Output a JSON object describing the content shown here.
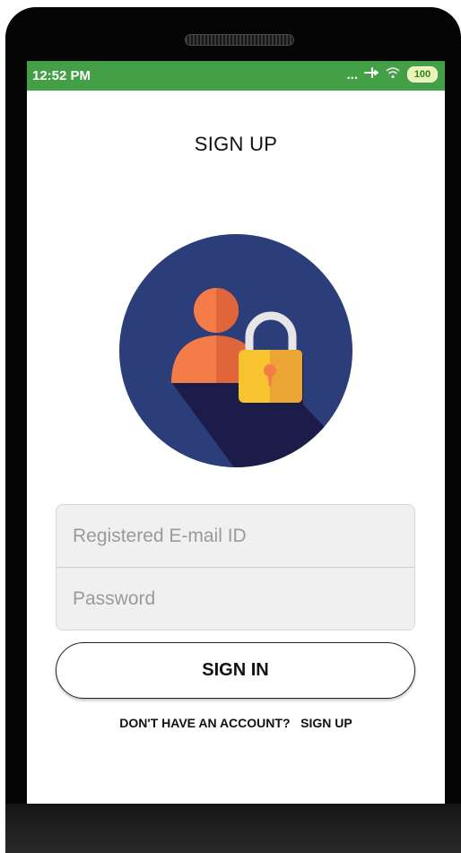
{
  "status_bar": {
    "time": "12:52 PM",
    "dots": "...",
    "battery": "100",
    "icons": [
      "airplane-icon",
      "wifi-icon",
      "battery-icon"
    ]
  },
  "page": {
    "title": "SIGN UP"
  },
  "form": {
    "email_placeholder": "Registered E-mail ID",
    "email_value": "",
    "password_placeholder": "Password",
    "password_value": ""
  },
  "actions": {
    "signin_label": "SIGN IN",
    "no_account_text": "DON'T HAVE AN ACCOUNT?",
    "signup_link": "SIGN UP"
  },
  "colors": {
    "status_bar": "#43a047",
    "logo_circle": "#2c3e7a",
    "logo_person": "#f47c48",
    "lock_body": "#f7c32e"
  }
}
